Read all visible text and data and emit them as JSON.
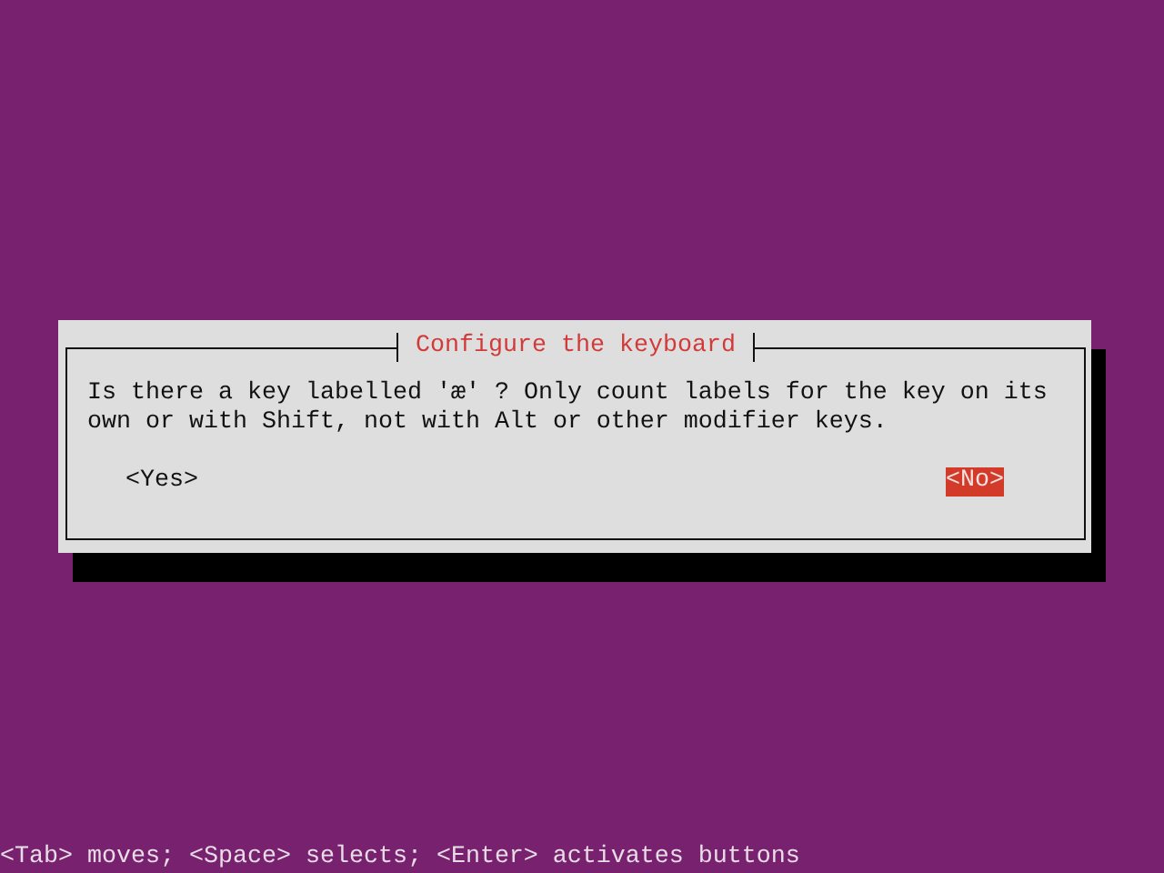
{
  "dialog": {
    "title": "Configure the keyboard",
    "message": "Is there a key labelled 'æ' ? Only count labels for the key on its own or with Shift, not with Alt or other modifier keys.",
    "buttons": [
      {
        "label": "<Yes>",
        "selected": false
      },
      {
        "label": "<No>",
        "selected": true
      }
    ]
  },
  "status_bar": "<Tab> moves; <Space> selects; <Enter> activates buttons"
}
